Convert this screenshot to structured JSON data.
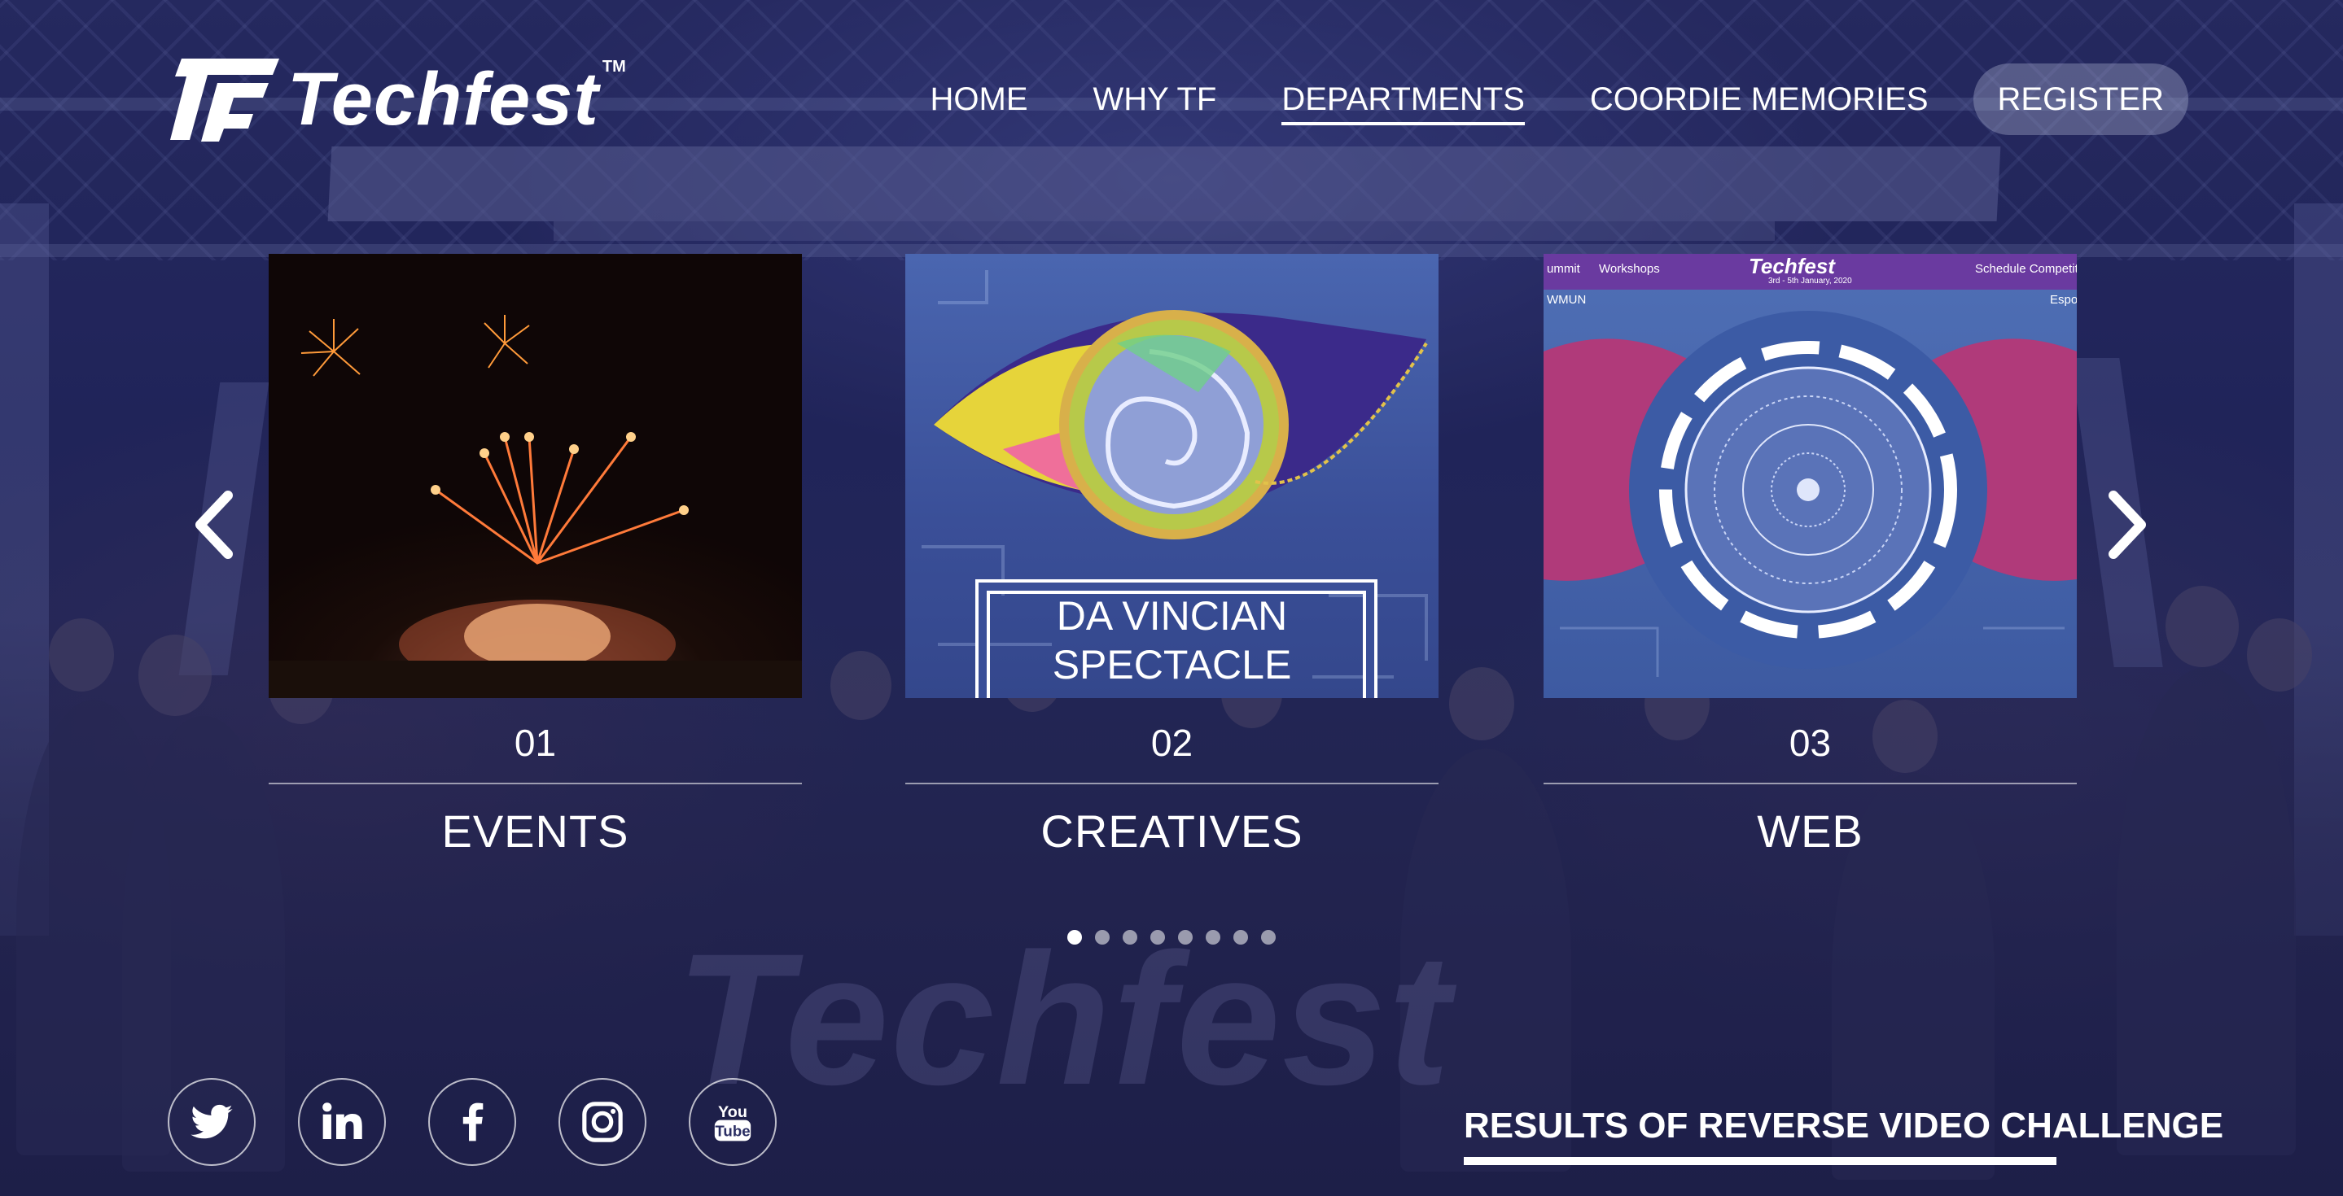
{
  "brand": {
    "name": "Techfest",
    "tm": "TM"
  },
  "nav": {
    "items": [
      {
        "label": "HOME"
      },
      {
        "label": "WHY TF"
      },
      {
        "label": "DEPARTMENTS"
      },
      {
        "label": "COORDIE MEMORIES"
      }
    ],
    "register_label": "REGISTER",
    "active_item": "DEPARTMENTS"
  },
  "carousel": {
    "cards": [
      {
        "number": "01",
        "label": "EVENTS",
        "image": "fireworks-photo"
      },
      {
        "number": "02",
        "label": "CREATIVES",
        "image": "eye-artwork",
        "image_text_line1": "DA VINCIAN",
        "image_text_line2": "SPECTACLE"
      },
      {
        "number": "03",
        "label": "WEB",
        "image": "techfest-website-poster",
        "poster_brand": "Techfest",
        "poster_dates": "3rd - 5th January, 2020",
        "poster_nav": [
          "ummit",
          "Workshops",
          "Schedule Competiti",
          "WMUN",
          "Espo"
        ]
      }
    ],
    "dot_count": 8,
    "active_dot": 0,
    "prev_icon": "chevron-left-icon",
    "next_icon": "chevron-right-icon"
  },
  "footer": {
    "socials": [
      "twitter-icon",
      "linkedin-icon",
      "facebook-icon",
      "instagram-icon",
      "youtube-icon"
    ],
    "youtube_text_top": "You",
    "youtube_text_bottom": "Tube",
    "results_link": "RESULTS OF REVERSE VIDEO CHALLENGE"
  },
  "background": {
    "watermark_text": "Techfest"
  },
  "colors": {
    "overlay": "#1c2058",
    "text": "#ffffff",
    "register_bg": "#b4b9d7"
  }
}
